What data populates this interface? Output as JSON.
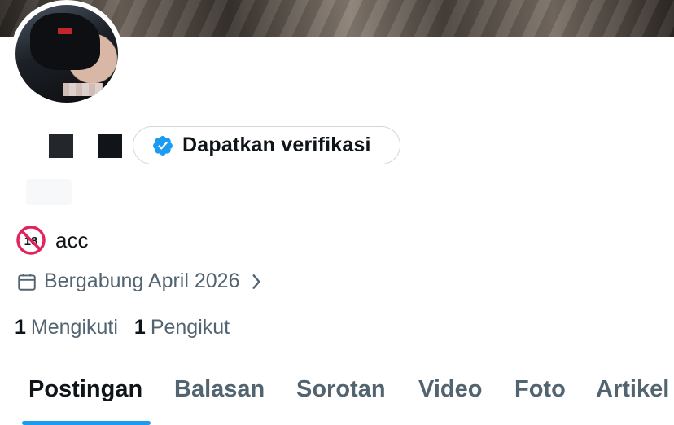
{
  "profile": {
    "verify_button_label": "Dapatkan verifikasi",
    "bio": "acc",
    "bio_icon": "no-under-18-icon",
    "joined_label": "Bergabung April 2026",
    "following_count": "1",
    "following_label": "Mengikuti",
    "followers_count": "1",
    "followers_label": "Pengikut"
  },
  "tabs": [
    {
      "label": "Postingan",
      "active": true
    },
    {
      "label": "Balasan",
      "active": false
    },
    {
      "label": "Sorotan",
      "active": false
    },
    {
      "label": "Video",
      "active": false
    },
    {
      "label": "Foto",
      "active": false
    },
    {
      "label": "Artikel",
      "active": false
    }
  ],
  "colors": {
    "accent": "#1d9bf0",
    "text_primary": "#0f1419",
    "text_secondary": "#536471",
    "border": "#cfd9de"
  }
}
